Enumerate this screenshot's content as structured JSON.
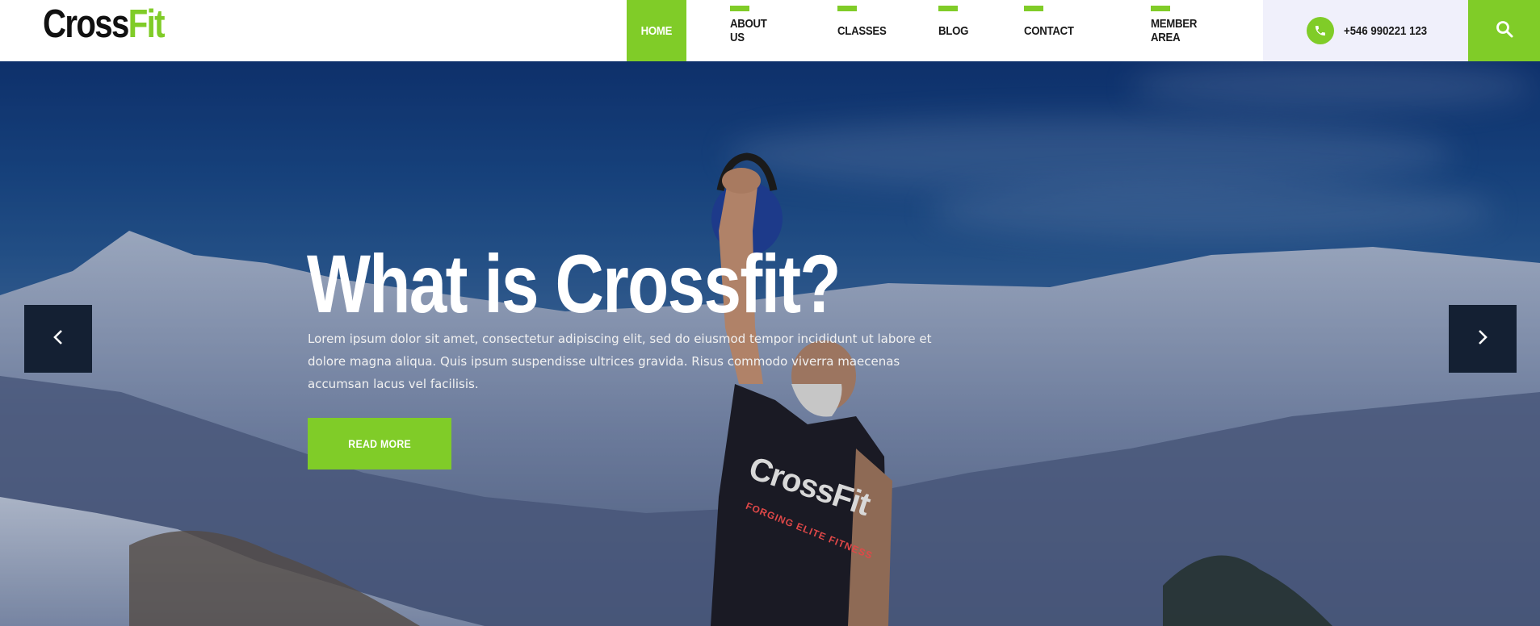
{
  "brand": {
    "logo_part1": "Cross",
    "logo_part2": "Fit"
  },
  "nav": {
    "items": [
      {
        "label": "HOME",
        "active": true
      },
      {
        "label": "ABOUT US",
        "active": false
      },
      {
        "label": "CLASSES",
        "active": false
      },
      {
        "label": "BLOG",
        "active": false
      },
      {
        "label": "CONTACT",
        "active": false
      },
      {
        "label": "MEMBER AREA",
        "active": false
      }
    ]
  },
  "contact": {
    "phone": "+546 990221 123",
    "icon": "phone-icon"
  },
  "search": {
    "icon": "search-icon"
  },
  "hero": {
    "title": "What is Crossfit?",
    "text": "Lorem ipsum dolor sit amet, consectetur adipiscing elit, sed do eiusmod tempor incididunt ut labore et dolore magna aliqua. Quis ipsum suspendisse ultrices gravida. Risus commodo viverra maecenas accumsan lacus vel facilisis.",
    "button_label": "READ MORE",
    "shirt_brand": "CrossFit",
    "shirt_tagline": "FORGING ELITE FITNESS",
    "prev_icon": "chevron-left-icon",
    "next_icon": "chevron-right-icon"
  },
  "colors": {
    "accent": "#80cc28",
    "dark": "#142033",
    "phone_bg": "#f0f0fb"
  }
}
